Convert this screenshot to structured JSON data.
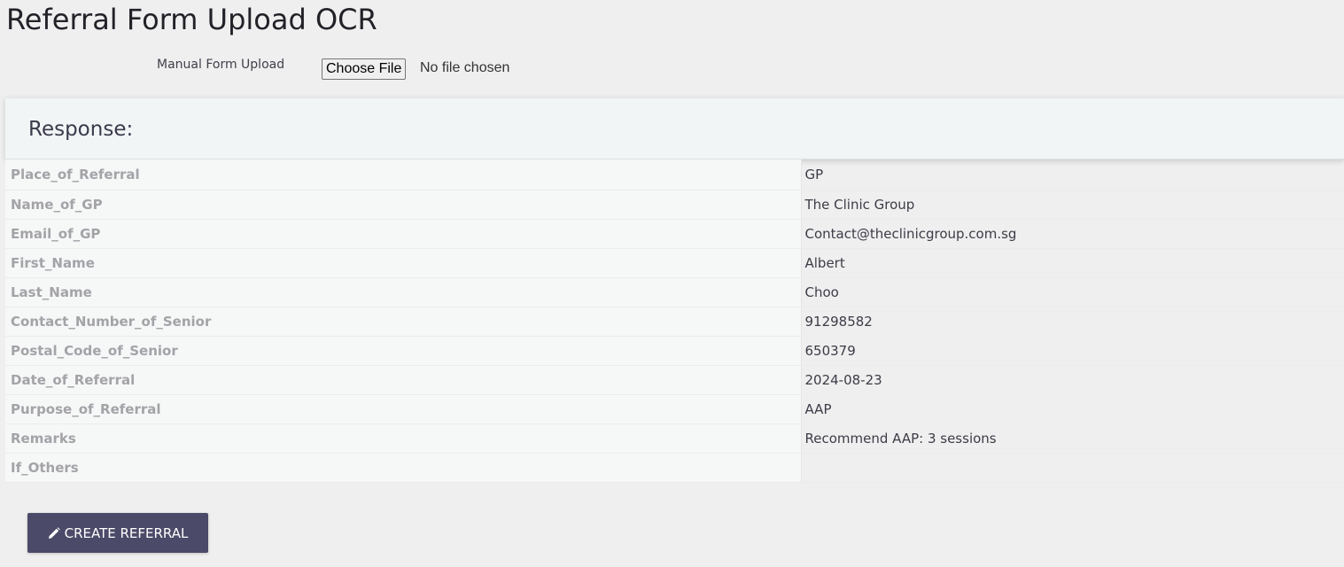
{
  "page": {
    "title": "Referral Form Upload OCR"
  },
  "upload": {
    "label": "Manual Form Upload",
    "button_label": "Choose File",
    "status": "No file chosen"
  },
  "response": {
    "heading": "Response:",
    "rows": [
      {
        "key": "Place_of_Referral",
        "value": "GP"
      },
      {
        "key": "Name_of_GP",
        "value": "The Clinic Group"
      },
      {
        "key": "Email_of_GP",
        "value": "Contact@theclinicgroup.com.sg"
      },
      {
        "key": "First_Name",
        "value": "Albert"
      },
      {
        "key": "Last_Name",
        "value": "Choo"
      },
      {
        "key": "Contact_Number_of_Senior",
        "value": "91298582"
      },
      {
        "key": "Postal_Code_of_Senior",
        "value": "650379"
      },
      {
        "key": "Date_of_Referral",
        "value": "2024-08-23"
      },
      {
        "key": "Purpose_of_Referral",
        "value": "AAP"
      },
      {
        "key": "Remarks",
        "value": "Recommend AAP: 3 sessions"
      },
      {
        "key": "If_Others",
        "value": ""
      }
    ]
  },
  "actions": {
    "create_label": "CREATE REFERRAL",
    "create_icon": "pencil-icon"
  },
  "colors": {
    "primary_button": "#4b4a68",
    "background": "#efefef",
    "card": "#f2f5f5"
  }
}
